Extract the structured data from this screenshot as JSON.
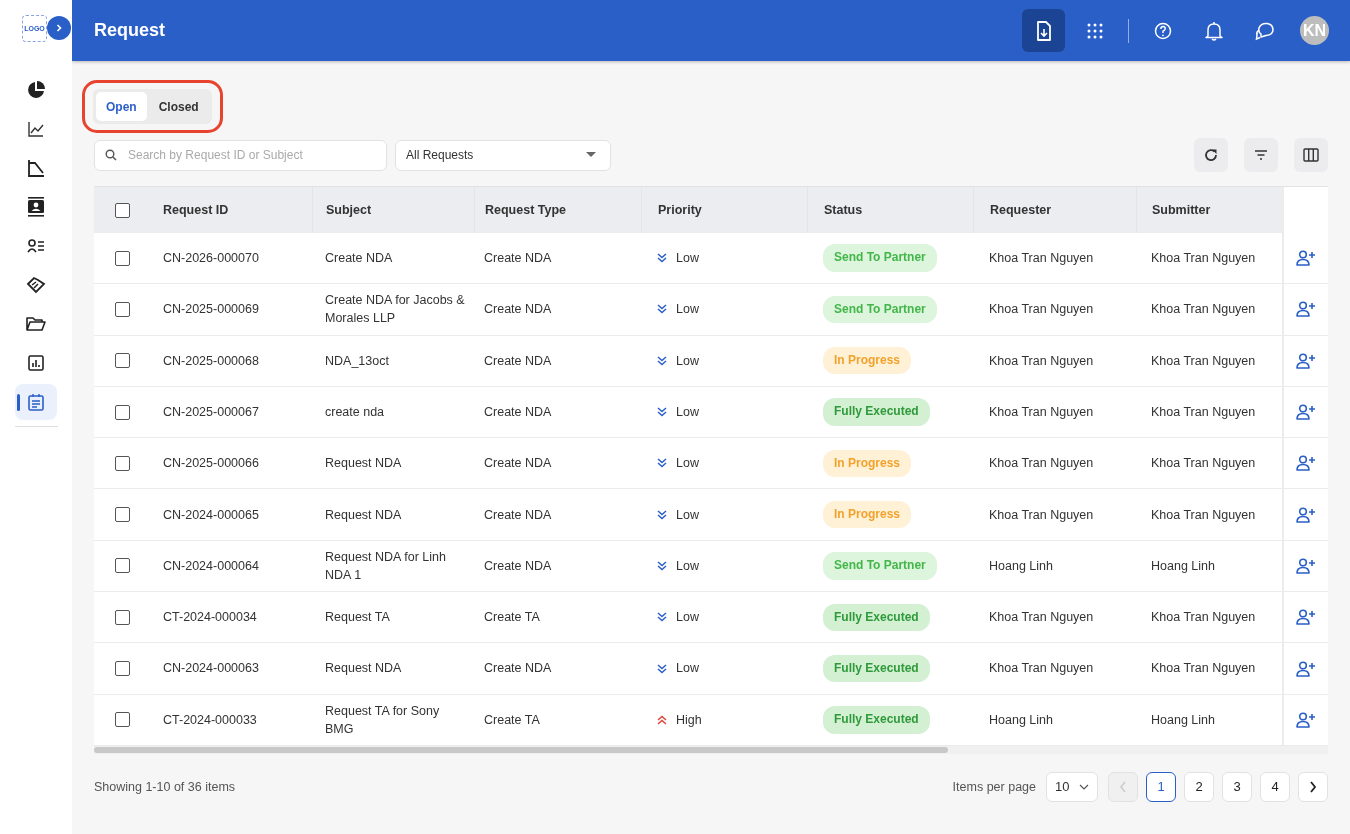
{
  "logo": {
    "text": "LOGO"
  },
  "sidebar": {
    "items": [
      {
        "selected": false
      },
      {
        "selected": false
      },
      {
        "selected": false
      },
      {
        "selected": false
      },
      {
        "selected": false
      },
      {
        "selected": false
      },
      {
        "selected": false
      },
      {
        "selected": false
      },
      {
        "selected": true
      }
    ]
  },
  "header": {
    "title": "Request",
    "avatar": "KN"
  },
  "tabs": [
    {
      "label": "Open",
      "selected": true
    },
    {
      "label": "Closed",
      "selected": false
    }
  ],
  "search": {
    "placeholder": "Search by Request ID or Subject"
  },
  "filter": {
    "value": "All Requests"
  },
  "table": {
    "select_all": {
      "checked": false
    },
    "columns": [
      "Request ID",
      "Subject",
      "Request Type",
      "Priority",
      "Status",
      "Requester",
      "Submitter"
    ],
    "rows": [
      {
        "checked": false,
        "id": "CN-2026-000070",
        "subject": "Create NDA",
        "type": "Create NDA",
        "priority": {
          "kind": "low",
          "label": "Low"
        },
        "status": {
          "kind": "sent",
          "label": "Send To Partner"
        },
        "requester": "Khoa Tran Nguyen",
        "submitter": "Khoa Tran Nguyen"
      },
      {
        "checked": false,
        "id": "CN-2025-000069",
        "subject": "Create NDA for Jacobs & Morales LLP",
        "type": "Create NDA",
        "priority": {
          "kind": "low",
          "label": "Low"
        },
        "status": {
          "kind": "sent",
          "label": "Send To Partner"
        },
        "requester": "Khoa Tran Nguyen",
        "submitter": "Khoa Tran Nguyen"
      },
      {
        "checked": false,
        "id": "CN-2025-000068",
        "subject": "NDA_13oct",
        "type": "Create NDA",
        "priority": {
          "kind": "low",
          "label": "Low"
        },
        "status": {
          "kind": "progress",
          "label": "In Progress"
        },
        "requester": "Khoa Tran Nguyen",
        "submitter": "Khoa Tran Nguyen"
      },
      {
        "checked": false,
        "id": "CN-2025-000067",
        "subject": "create nda",
        "type": "Create NDA",
        "priority": {
          "kind": "low",
          "label": "Low"
        },
        "status": {
          "kind": "executed",
          "label": "Fully Executed"
        },
        "requester": "Khoa Tran Nguyen",
        "submitter": "Khoa Tran Nguyen"
      },
      {
        "checked": false,
        "id": "CN-2025-000066",
        "subject": "Request NDA",
        "type": "Create NDA",
        "priority": {
          "kind": "low",
          "label": "Low"
        },
        "status": {
          "kind": "progress",
          "label": "In Progress"
        },
        "requester": "Khoa Tran Nguyen",
        "submitter": "Khoa Tran Nguyen"
      },
      {
        "checked": false,
        "id": "CN-2024-000065",
        "subject": "Request NDA",
        "type": "Create NDA",
        "priority": {
          "kind": "low",
          "label": "Low"
        },
        "status": {
          "kind": "progress",
          "label": "In Progress"
        },
        "requester": "Khoa Tran Nguyen",
        "submitter": "Khoa Tran Nguyen"
      },
      {
        "checked": false,
        "id": "CN-2024-000064",
        "subject": "Request NDA for Linh NDA 1",
        "type": "Create NDA",
        "priority": {
          "kind": "low",
          "label": "Low"
        },
        "status": {
          "kind": "sent",
          "label": "Send To Partner"
        },
        "requester": "Hoang Linh",
        "submitter": "Hoang Linh"
      },
      {
        "checked": false,
        "id": "CT-2024-000034",
        "subject": "Request TA",
        "type": "Create TA",
        "priority": {
          "kind": "low",
          "label": "Low"
        },
        "status": {
          "kind": "executed",
          "label": "Fully Executed"
        },
        "requester": "Khoa Tran Nguyen",
        "submitter": "Khoa Tran Nguyen"
      },
      {
        "checked": false,
        "id": "CN-2024-000063",
        "subject": "Request NDA",
        "type": "Create NDA",
        "priority": {
          "kind": "low",
          "label": "Low"
        },
        "status": {
          "kind": "executed",
          "label": "Fully Executed"
        },
        "requester": "Khoa Tran Nguyen",
        "submitter": "Khoa Tran Nguyen"
      },
      {
        "checked": false,
        "id": "CT-2024-000033",
        "subject": "Request TA for Sony BMG",
        "type": "Create TA",
        "priority": {
          "kind": "high",
          "label": "High"
        },
        "status": {
          "kind": "executed",
          "label": "Fully Executed"
        },
        "requester": "Hoang Linh",
        "submitter": "Hoang Linh"
      }
    ]
  },
  "footer": {
    "summary": "Showing 1-10 of 36 items",
    "per_page_label": "Items per page",
    "per_page": "10",
    "prev": {
      "disabled": true
    },
    "pages": [
      {
        "label": "1",
        "selected": true
      },
      {
        "label": "2",
        "selected": false
      },
      {
        "label": "3",
        "selected": false
      },
      {
        "label": "4",
        "selected": false
      }
    ],
    "next": {
      "disabled": false
    }
  }
}
